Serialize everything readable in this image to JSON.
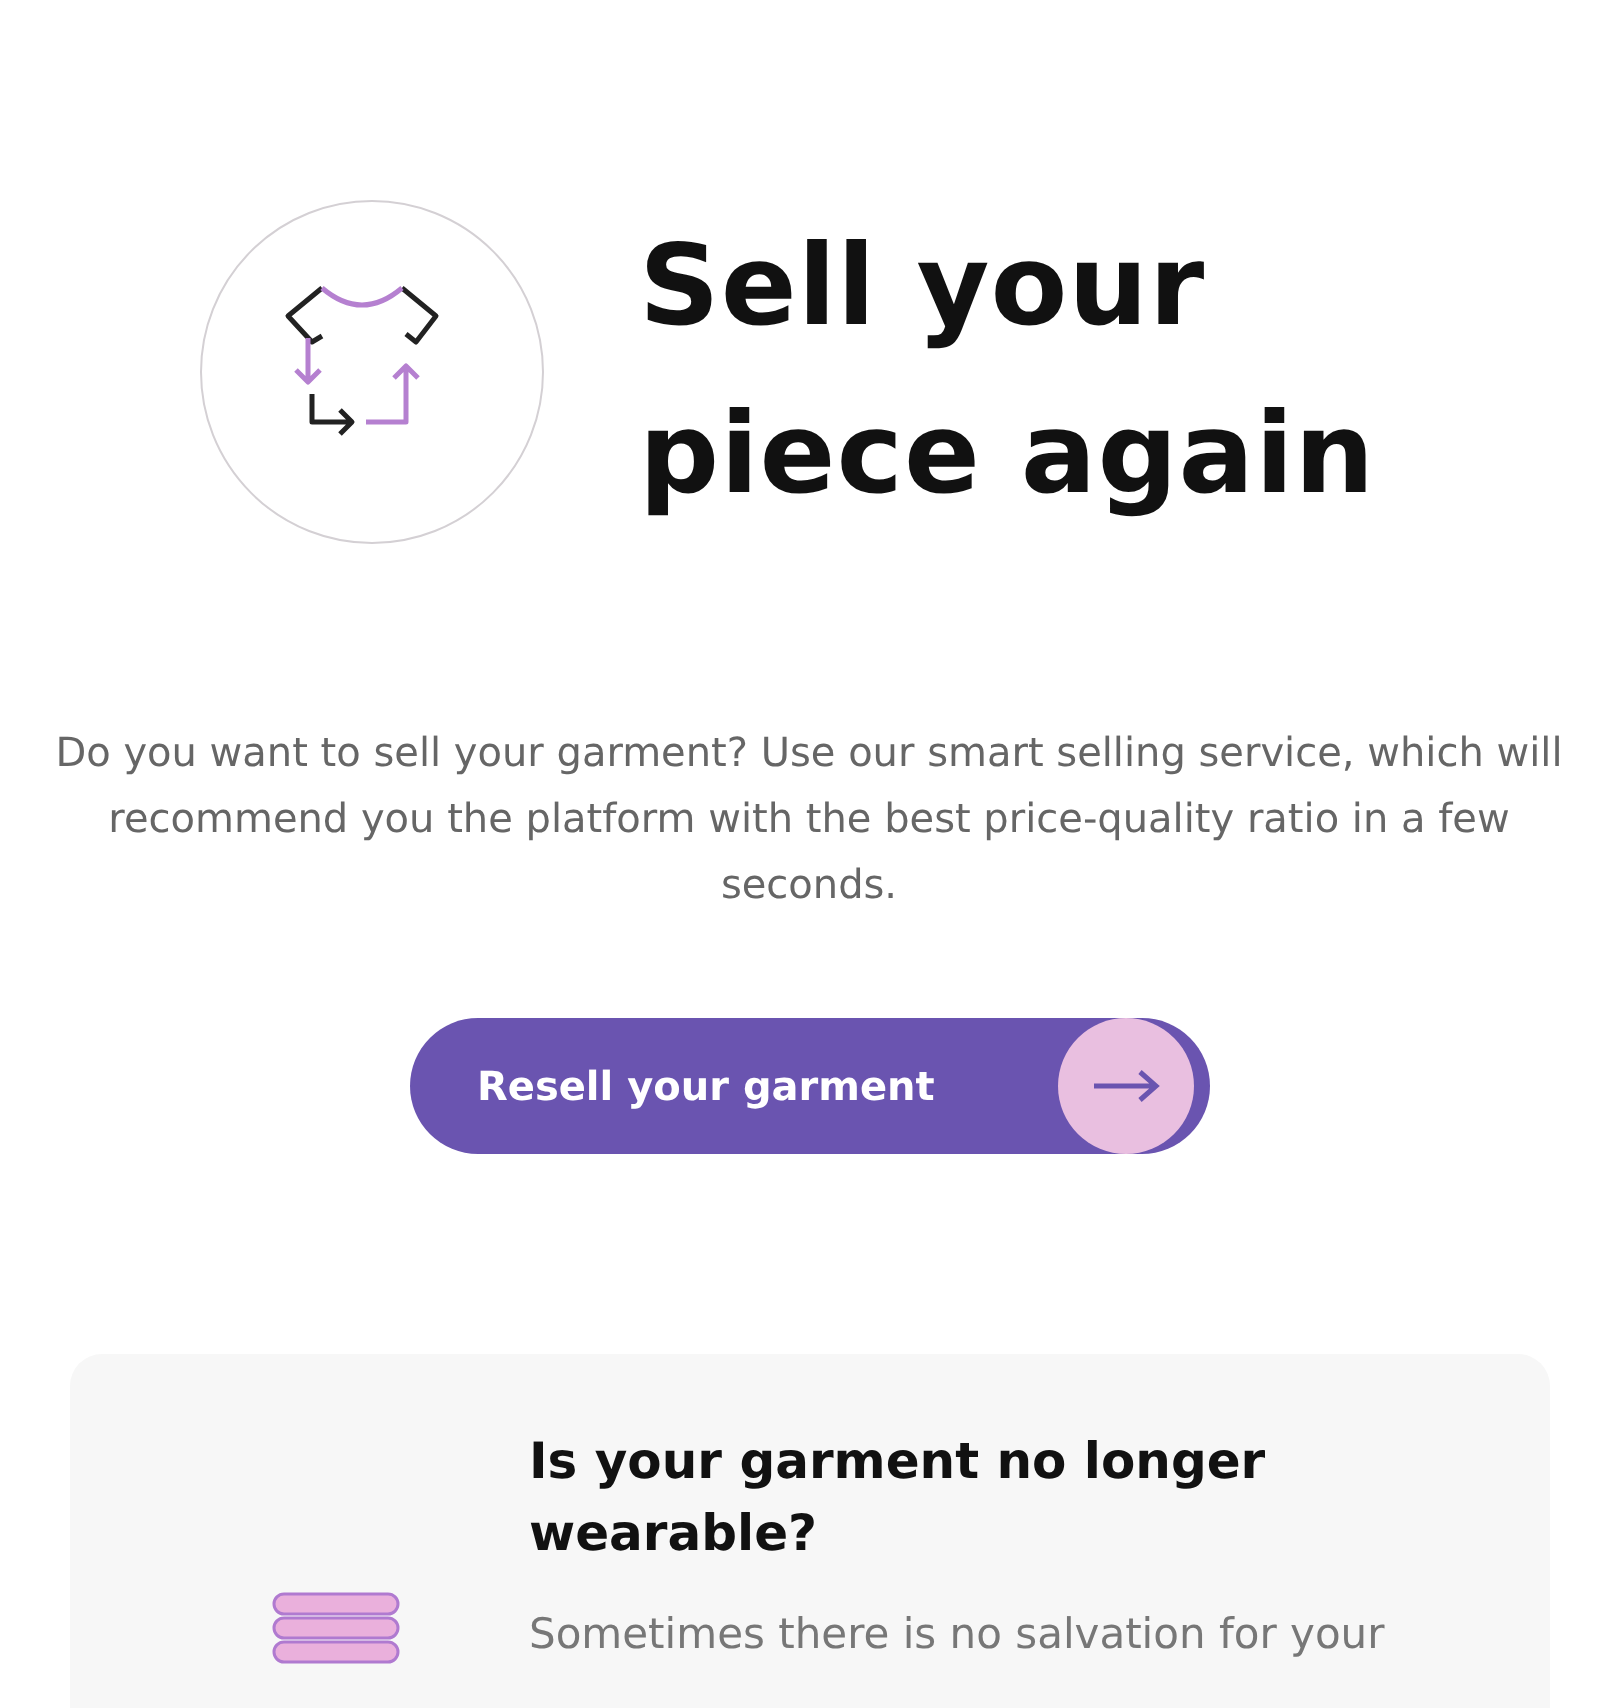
{
  "hero": {
    "title_lines": [
      "Sell your",
      "piece again"
    ]
  },
  "description": "Do you want to sell your garment? Use our smart selling service, which will recommend you the platform with the best price-quality ratio in a few seconds.",
  "cta_button": {
    "label": "Resell your garment"
  },
  "card": {
    "title": "Is your garment no longer wearable?",
    "text": "Sometimes there is no salvation for your"
  }
}
